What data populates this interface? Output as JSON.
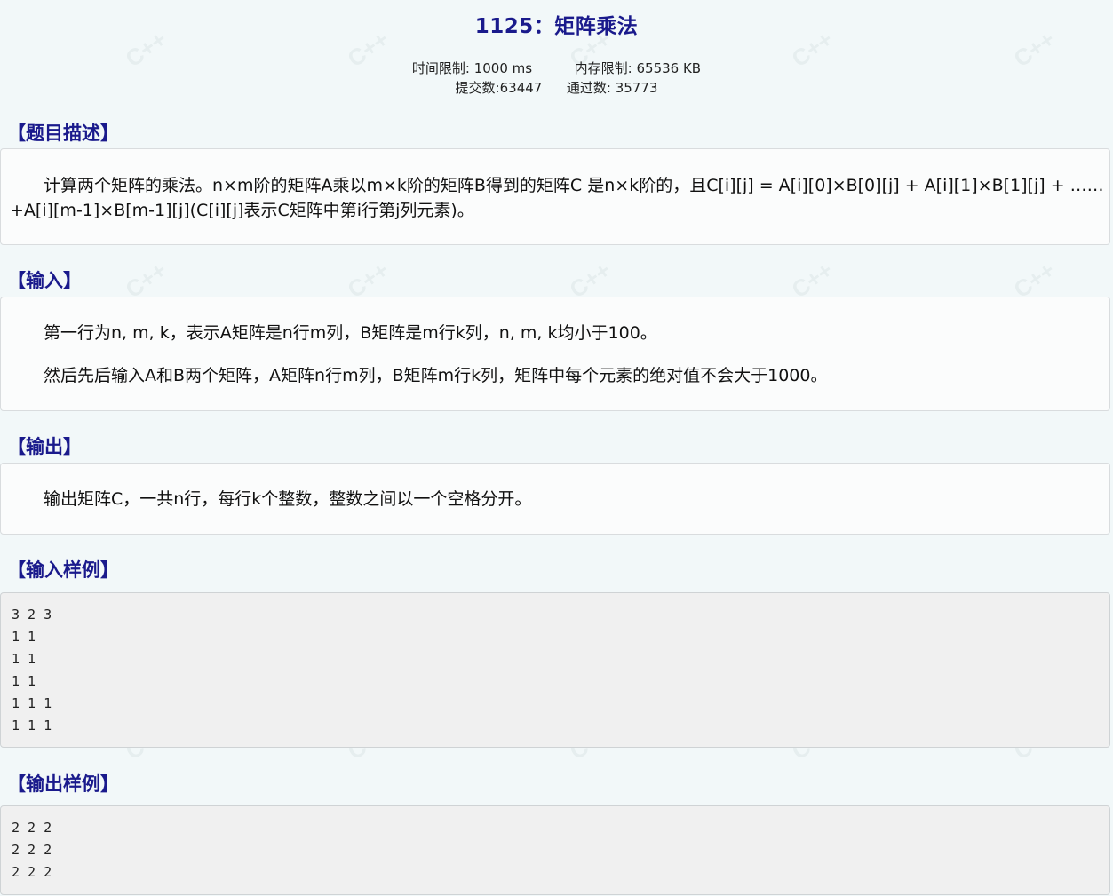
{
  "problem": {
    "title": "1125：矩阵乘法",
    "time_limit": "时间限制: 1000 ms",
    "memory_limit": "内存限制: 65536 KB",
    "submissions": "提交数:63447",
    "accepted": "通过数: 35773"
  },
  "sections": {
    "description_title": "【题目描述】",
    "description_line1": "计算两个矩阵的乘法。n×m阶的矩阵A乘以m×k阶的矩阵B得到的矩阵C 是n×k阶的，且C[i][j] = A[i][0]×B[0][j] + A[i][1]×B[1][j] + ……",
    "description_line2": "+A[i][m-1]×B[m-1][j](C[i][j]表示C矩阵中第i行第j列元素)。",
    "input_title": "【输入】",
    "input_line1": "第一行为n, m, k，表示A矩阵是n行m列，B矩阵是m行k列，n, m, k均小于100。",
    "input_line2": "然后先后输入A和B两个矩阵，A矩阵n行m列，B矩阵m行k列，矩阵中每个元素的绝对值不会大于1000。",
    "output_title": "【输出】",
    "output_line1": "输出矩阵C，一共n行，每行k个整数，整数之间以一个空格分开。",
    "sample_input_title": "【输入样例】",
    "sample_input_lines": [
      "3 2 3",
      "1 1",
      "1 1",
      "1 1",
      "1 1 1",
      "1 1 1"
    ],
    "sample_output_title": "【输出样例】",
    "sample_output_lines": [
      "2 2 2",
      "2 2 2",
      "2 2 2"
    ]
  },
  "watermark": {
    "text": "C++"
  },
  "colors": {
    "heading": "#1a1a8c",
    "background": "#f2f8f9",
    "box": "#fbfcfc",
    "code_box": "#f0f0f0"
  }
}
